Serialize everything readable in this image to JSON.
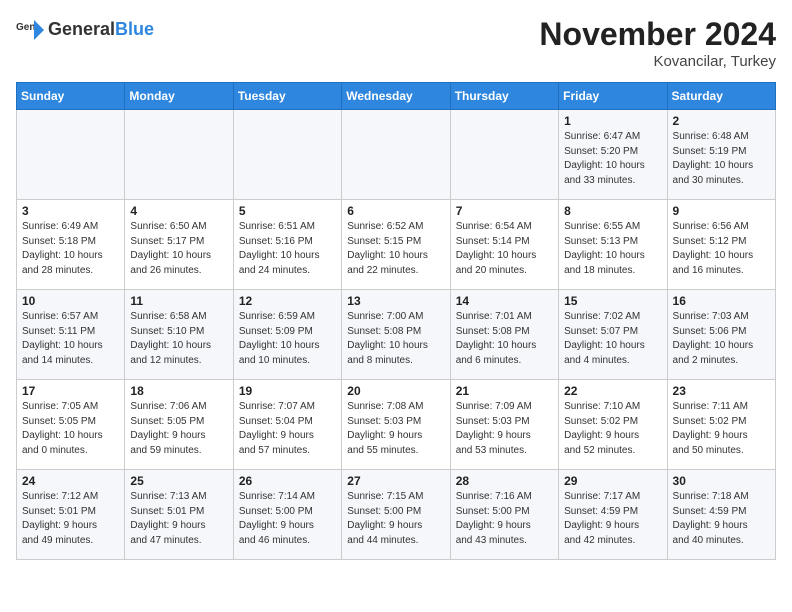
{
  "logo": {
    "general": "General",
    "blue": "Blue"
  },
  "title": {
    "month": "November 2024",
    "location": "Kovancilar, Turkey"
  },
  "headers": [
    "Sunday",
    "Monday",
    "Tuesday",
    "Wednesday",
    "Thursday",
    "Friday",
    "Saturday"
  ],
  "weeks": [
    [
      {
        "day": "",
        "info": ""
      },
      {
        "day": "",
        "info": ""
      },
      {
        "day": "",
        "info": ""
      },
      {
        "day": "",
        "info": ""
      },
      {
        "day": "",
        "info": ""
      },
      {
        "day": "1",
        "info": "Sunrise: 6:47 AM\nSunset: 5:20 PM\nDaylight: 10 hours\nand 33 minutes."
      },
      {
        "day": "2",
        "info": "Sunrise: 6:48 AM\nSunset: 5:19 PM\nDaylight: 10 hours\nand 30 minutes."
      }
    ],
    [
      {
        "day": "3",
        "info": "Sunrise: 6:49 AM\nSunset: 5:18 PM\nDaylight: 10 hours\nand 28 minutes."
      },
      {
        "day": "4",
        "info": "Sunrise: 6:50 AM\nSunset: 5:17 PM\nDaylight: 10 hours\nand 26 minutes."
      },
      {
        "day": "5",
        "info": "Sunrise: 6:51 AM\nSunset: 5:16 PM\nDaylight: 10 hours\nand 24 minutes."
      },
      {
        "day": "6",
        "info": "Sunrise: 6:52 AM\nSunset: 5:15 PM\nDaylight: 10 hours\nand 22 minutes."
      },
      {
        "day": "7",
        "info": "Sunrise: 6:54 AM\nSunset: 5:14 PM\nDaylight: 10 hours\nand 20 minutes."
      },
      {
        "day": "8",
        "info": "Sunrise: 6:55 AM\nSunset: 5:13 PM\nDaylight: 10 hours\nand 18 minutes."
      },
      {
        "day": "9",
        "info": "Sunrise: 6:56 AM\nSunset: 5:12 PM\nDaylight: 10 hours\nand 16 minutes."
      }
    ],
    [
      {
        "day": "10",
        "info": "Sunrise: 6:57 AM\nSunset: 5:11 PM\nDaylight: 10 hours\nand 14 minutes."
      },
      {
        "day": "11",
        "info": "Sunrise: 6:58 AM\nSunset: 5:10 PM\nDaylight: 10 hours\nand 12 minutes."
      },
      {
        "day": "12",
        "info": "Sunrise: 6:59 AM\nSunset: 5:09 PM\nDaylight: 10 hours\nand 10 minutes."
      },
      {
        "day": "13",
        "info": "Sunrise: 7:00 AM\nSunset: 5:08 PM\nDaylight: 10 hours\nand 8 minutes."
      },
      {
        "day": "14",
        "info": "Sunrise: 7:01 AM\nSunset: 5:08 PM\nDaylight: 10 hours\nand 6 minutes."
      },
      {
        "day": "15",
        "info": "Sunrise: 7:02 AM\nSunset: 5:07 PM\nDaylight: 10 hours\nand 4 minutes."
      },
      {
        "day": "16",
        "info": "Sunrise: 7:03 AM\nSunset: 5:06 PM\nDaylight: 10 hours\nand 2 minutes."
      }
    ],
    [
      {
        "day": "17",
        "info": "Sunrise: 7:05 AM\nSunset: 5:05 PM\nDaylight: 10 hours\nand 0 minutes."
      },
      {
        "day": "18",
        "info": "Sunrise: 7:06 AM\nSunset: 5:05 PM\nDaylight: 9 hours\nand 59 minutes."
      },
      {
        "day": "19",
        "info": "Sunrise: 7:07 AM\nSunset: 5:04 PM\nDaylight: 9 hours\nand 57 minutes."
      },
      {
        "day": "20",
        "info": "Sunrise: 7:08 AM\nSunset: 5:03 PM\nDaylight: 9 hours\nand 55 minutes."
      },
      {
        "day": "21",
        "info": "Sunrise: 7:09 AM\nSunset: 5:03 PM\nDaylight: 9 hours\nand 53 minutes."
      },
      {
        "day": "22",
        "info": "Sunrise: 7:10 AM\nSunset: 5:02 PM\nDaylight: 9 hours\nand 52 minutes."
      },
      {
        "day": "23",
        "info": "Sunrise: 7:11 AM\nSunset: 5:02 PM\nDaylight: 9 hours\nand 50 minutes."
      }
    ],
    [
      {
        "day": "24",
        "info": "Sunrise: 7:12 AM\nSunset: 5:01 PM\nDaylight: 9 hours\nand 49 minutes."
      },
      {
        "day": "25",
        "info": "Sunrise: 7:13 AM\nSunset: 5:01 PM\nDaylight: 9 hours\nand 47 minutes."
      },
      {
        "day": "26",
        "info": "Sunrise: 7:14 AM\nSunset: 5:00 PM\nDaylight: 9 hours\nand 46 minutes."
      },
      {
        "day": "27",
        "info": "Sunrise: 7:15 AM\nSunset: 5:00 PM\nDaylight: 9 hours\nand 44 minutes."
      },
      {
        "day": "28",
        "info": "Sunrise: 7:16 AM\nSunset: 5:00 PM\nDaylight: 9 hours\nand 43 minutes."
      },
      {
        "day": "29",
        "info": "Sunrise: 7:17 AM\nSunset: 4:59 PM\nDaylight: 9 hours\nand 42 minutes."
      },
      {
        "day": "30",
        "info": "Sunrise: 7:18 AM\nSunset: 4:59 PM\nDaylight: 9 hours\nand 40 minutes."
      }
    ]
  ]
}
